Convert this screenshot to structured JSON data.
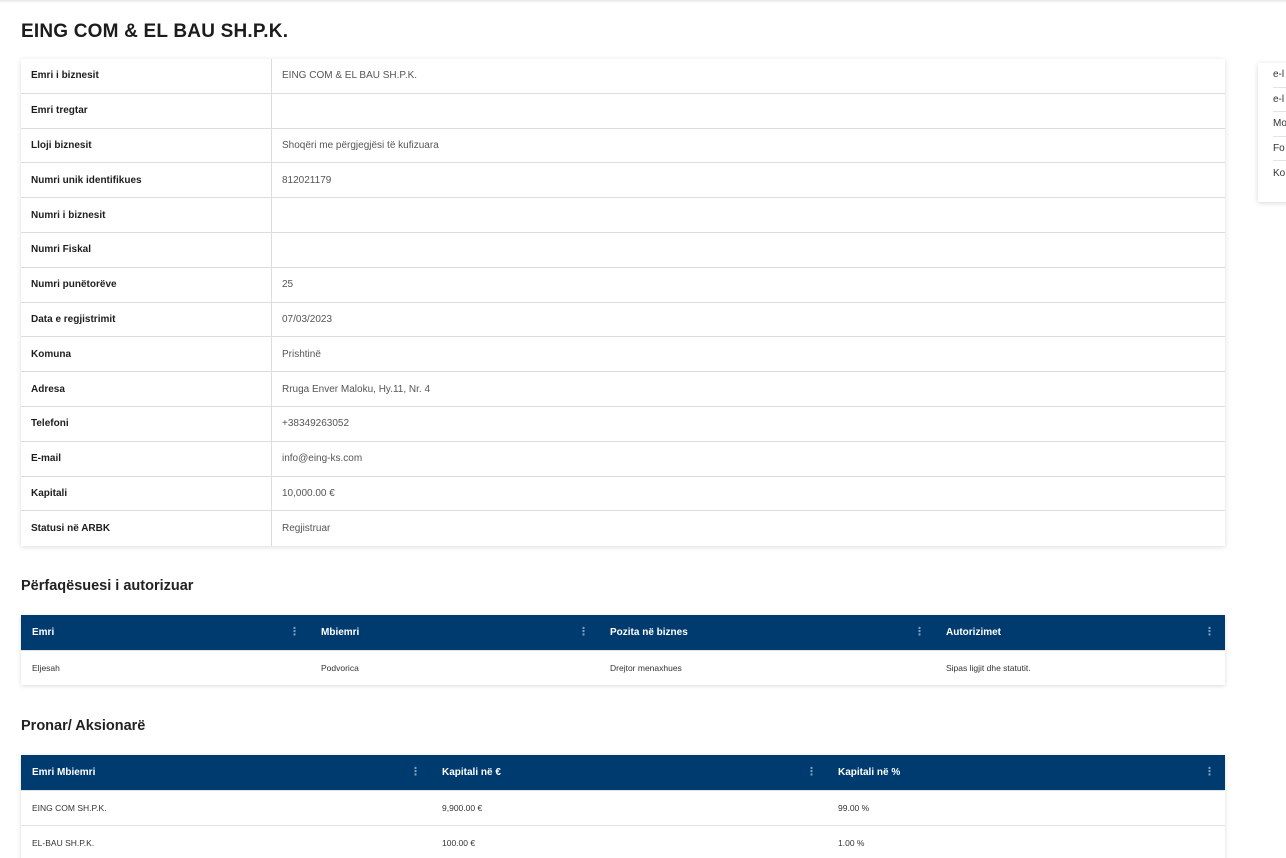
{
  "page": {
    "title": "EING COM & EL BAU SH.P.K."
  },
  "info": [
    {
      "label": "Emri i biznesit",
      "value": "EING COM & EL BAU SH.P.K."
    },
    {
      "label": "Emri tregtar",
      "value": ""
    },
    {
      "label": "Lloji biznesit",
      "value": "Shoqëri me përgjegjësi të kufizuara"
    },
    {
      "label": "Numri unik identifikues",
      "value": "812021179"
    },
    {
      "label": "Numri i biznesit",
      "value": ""
    },
    {
      "label": "Numri Fiskal",
      "value": ""
    },
    {
      "label": "Numri punëtorëve",
      "value": "25"
    },
    {
      "label": "Data e regjistrimit",
      "value": "07/03/2023"
    },
    {
      "label": "Komuna",
      "value": "Prishtinë"
    },
    {
      "label": "Adresa",
      "value": "Rruga Enver Maloku, Hy.11, Nr. 4"
    },
    {
      "label": "Telefoni",
      "value": "+38349263052"
    },
    {
      "label": "E-mail",
      "value": "info@eing-ks.com"
    },
    {
      "label": "Kapitali",
      "value": "10,000.00 €"
    },
    {
      "label": "Statusi në ARBK",
      "value": "Regjistruar"
    }
  ],
  "representatives": {
    "title": "Përfaqësuesi i autorizuar",
    "columns": [
      "Emri",
      "Mbiemri",
      "Pozita në biznes",
      "Autorizimet"
    ],
    "rows": [
      [
        "Eljesah",
        "Podvorica",
        "Drejtor menaxhues",
        "Sipas ligjit dhe statutit."
      ]
    ]
  },
  "owners": {
    "title": "Pronar/ Aksionarë",
    "columns": [
      "Emri Mbiemri",
      "Kapitali në €",
      "Kapitali në %"
    ],
    "rows": [
      [
        "EING COM SH.P.K.",
        "9,900.00 €",
        "99.00 %"
      ],
      [
        "EL-BAU SH.P.K.",
        "100.00 €",
        "1.00 %"
      ]
    ]
  },
  "side_menu": [
    "e-l",
    "e-l",
    "Mo",
    "Fo",
    "Ko"
  ],
  "colors": {
    "header_bg": "#003b6f",
    "header_text": "#ffffff"
  },
  "icons": {
    "column_menu": "vertical-dots-icon"
  }
}
